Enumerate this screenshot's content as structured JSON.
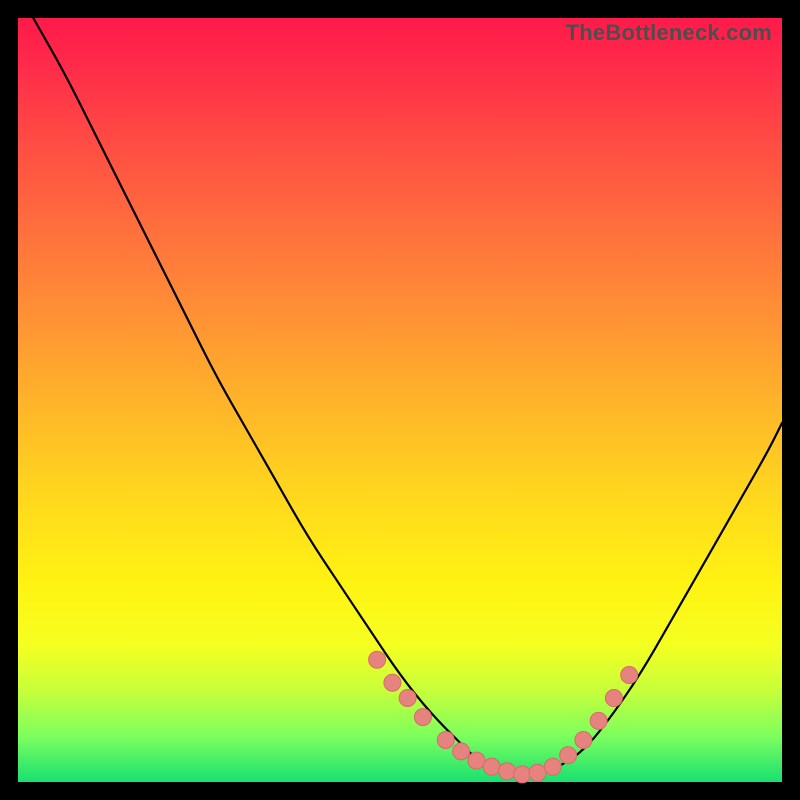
{
  "watermark": "TheBottleneck.com",
  "chart_data": {
    "type": "line",
    "title": "",
    "xlabel": "",
    "ylabel": "",
    "xlim": [
      0,
      100
    ],
    "ylim": [
      0,
      100
    ],
    "grid": false,
    "legend": false,
    "background_gradient": [
      "#ff1a4a",
      "#ff4545",
      "#ff8e36",
      "#ffd61e",
      "#fff312",
      "#c7ff3a",
      "#18e070"
    ],
    "series": [
      {
        "name": "bottleneck-curve",
        "x": [
          2,
          6,
          10,
          14,
          18,
          22,
          26,
          30,
          34,
          38,
          42,
          46,
          50,
          54,
          58,
          60,
          63,
          66,
          70,
          74,
          78,
          82,
          86,
          90,
          94,
          98,
          100
        ],
        "y": [
          100,
          93,
          85,
          77,
          69,
          61,
          53,
          46,
          39,
          32,
          26,
          20,
          14,
          9,
          5,
          3,
          1.5,
          1,
          1.5,
          4,
          9,
          15,
          22,
          29,
          36,
          43,
          47
        ]
      }
    ],
    "highlight_points": {
      "name": "marked-range",
      "color": "#e6837f",
      "x": [
        47,
        49,
        51,
        53,
        56,
        58,
        60,
        62,
        64,
        66,
        68,
        70,
        72,
        74,
        76,
        78,
        80
      ],
      "y": [
        16,
        13,
        11,
        8.5,
        5.5,
        4,
        2.8,
        2,
        1.4,
        1,
        1.2,
        2,
        3.5,
        5.5,
        8,
        11,
        14
      ]
    }
  }
}
